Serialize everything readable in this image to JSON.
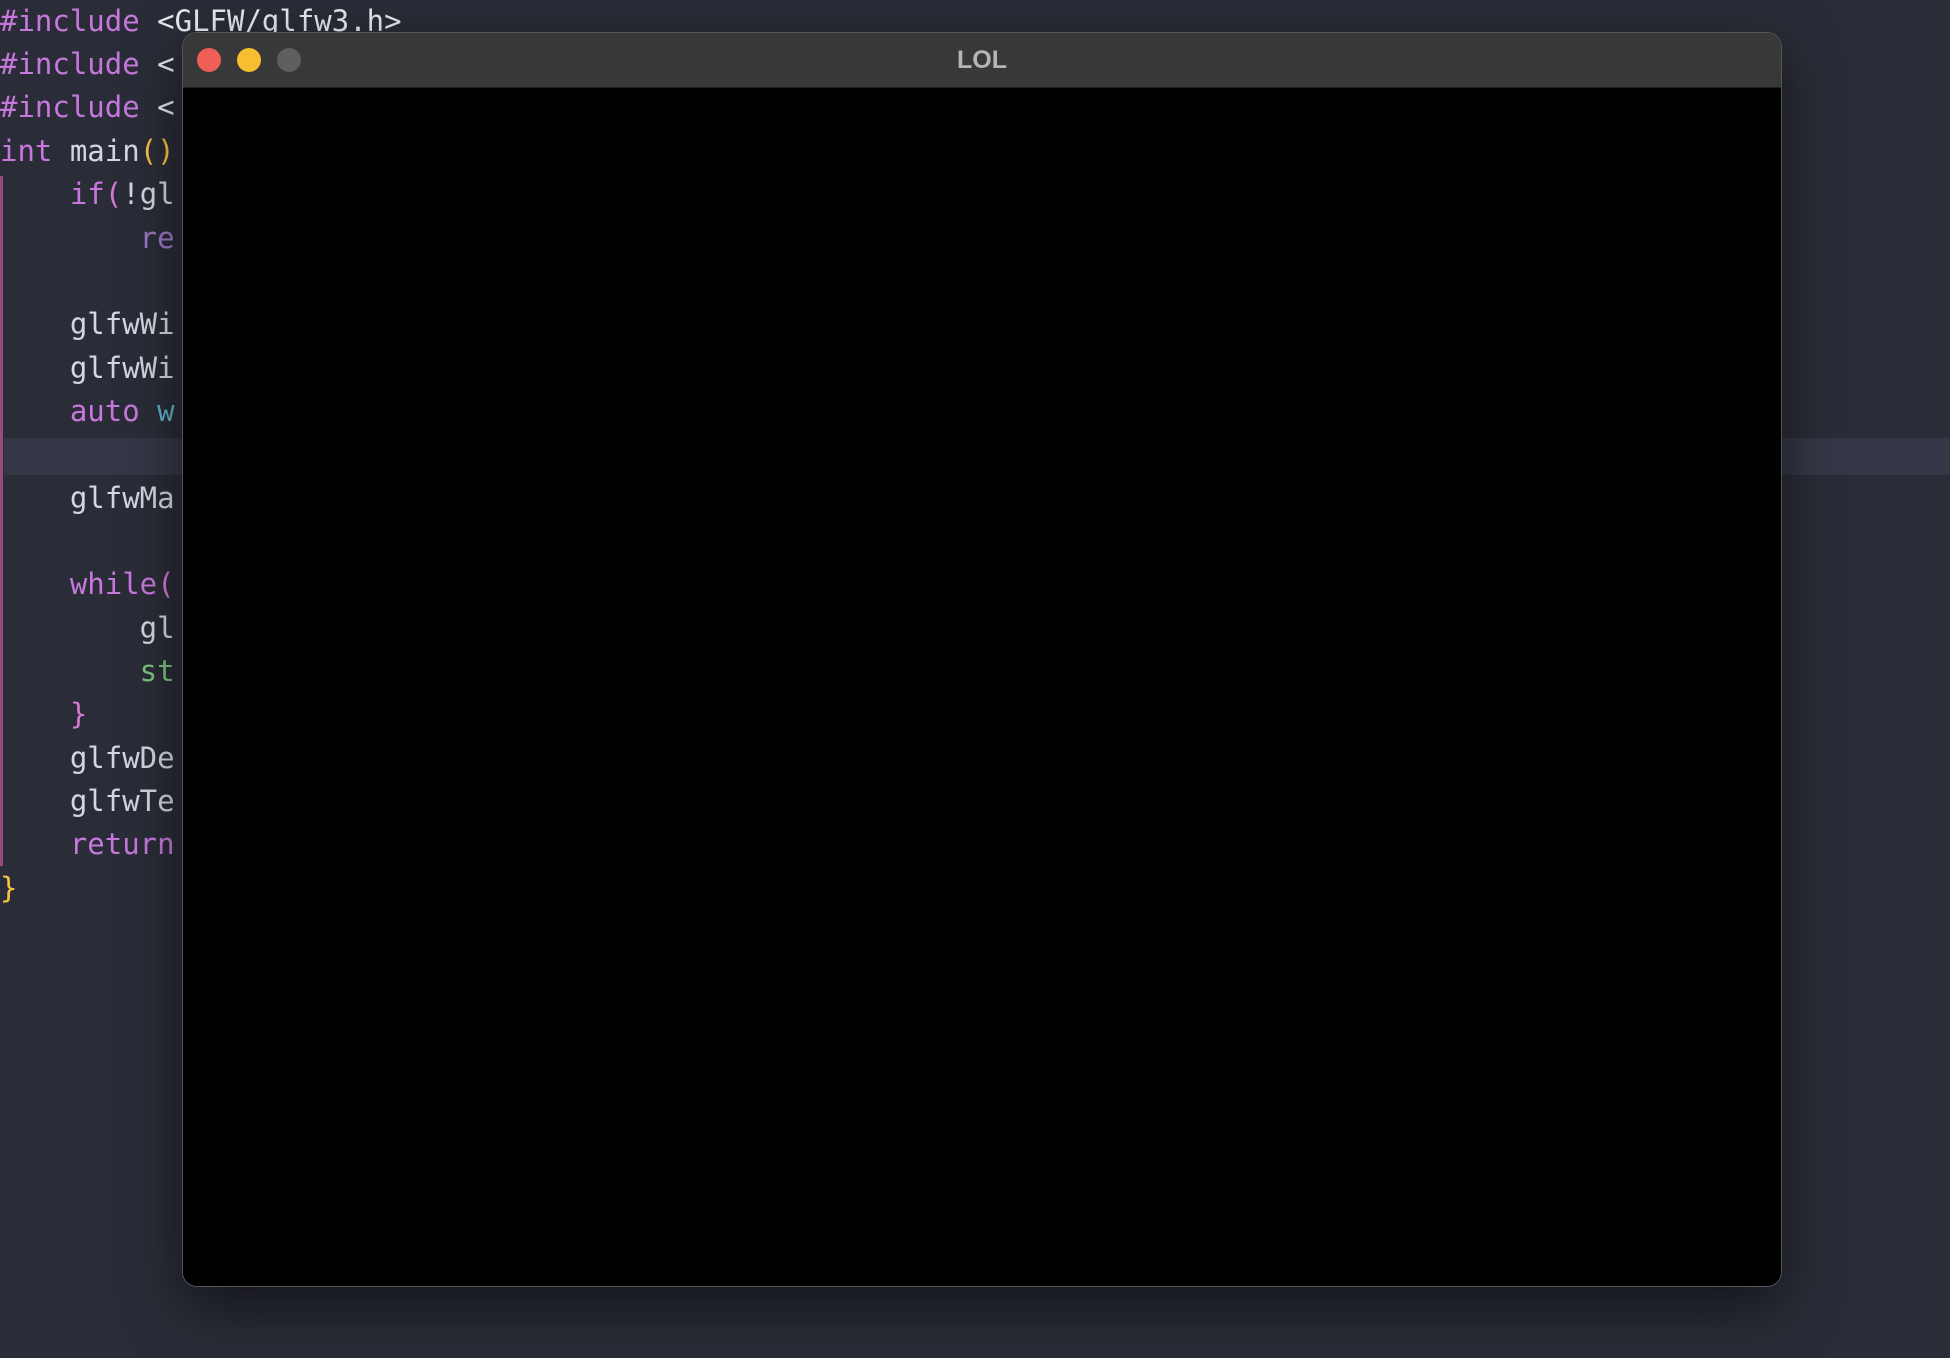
{
  "editor": {
    "lines": {
      "l1": {
        "kw": "#include",
        "rest": " <GLFW/glfw3.h>"
      },
      "l2": {
        "kw": "#include",
        "rest": " <"
      },
      "l3": {
        "kw": "#include",
        "rest": " <"
      },
      "l4": {
        "kw": "int",
        "fn": " main",
        "br": "()"
      },
      "l5": {
        "kw": "    if",
        "br": "(",
        "rest": "!gl"
      },
      "l6": {
        "ret": "        re"
      },
      "l8": {
        "fn": "    glfwWi"
      },
      "l9": {
        "fn": "    glfwWi"
      },
      "l10": {
        "kw": "    auto",
        "var": " w"
      },
      "l12": {
        "fn": "    glfwMa"
      },
      "l14": {
        "kw": "    while",
        "br": "("
      },
      "l15": {
        "fn": "        gl"
      },
      "l16": {
        "str": "        st"
      },
      "l17": {
        "br": "    }"
      },
      "l18": {
        "fn": "    glfwDe"
      },
      "l19": {
        "fn": "    glfwTe"
      },
      "l20": {
        "kw": "    return"
      },
      "l21": {
        "br": "}"
      }
    }
  },
  "window": {
    "title": "LOL"
  },
  "colors": {
    "editor_bg": "#2a2c37",
    "keyword": "#c678dd",
    "variable": "#5fb3c9",
    "string": "#7cc47f",
    "bracket": "#f5c542",
    "titlebar": "#383838",
    "close": "#ee5f57",
    "minimize": "#f7bf2f",
    "zoom": "#5f5f5f"
  },
  "icons": {
    "close": "close-icon",
    "minimize": "minimize-icon",
    "zoom": "zoom-icon"
  }
}
